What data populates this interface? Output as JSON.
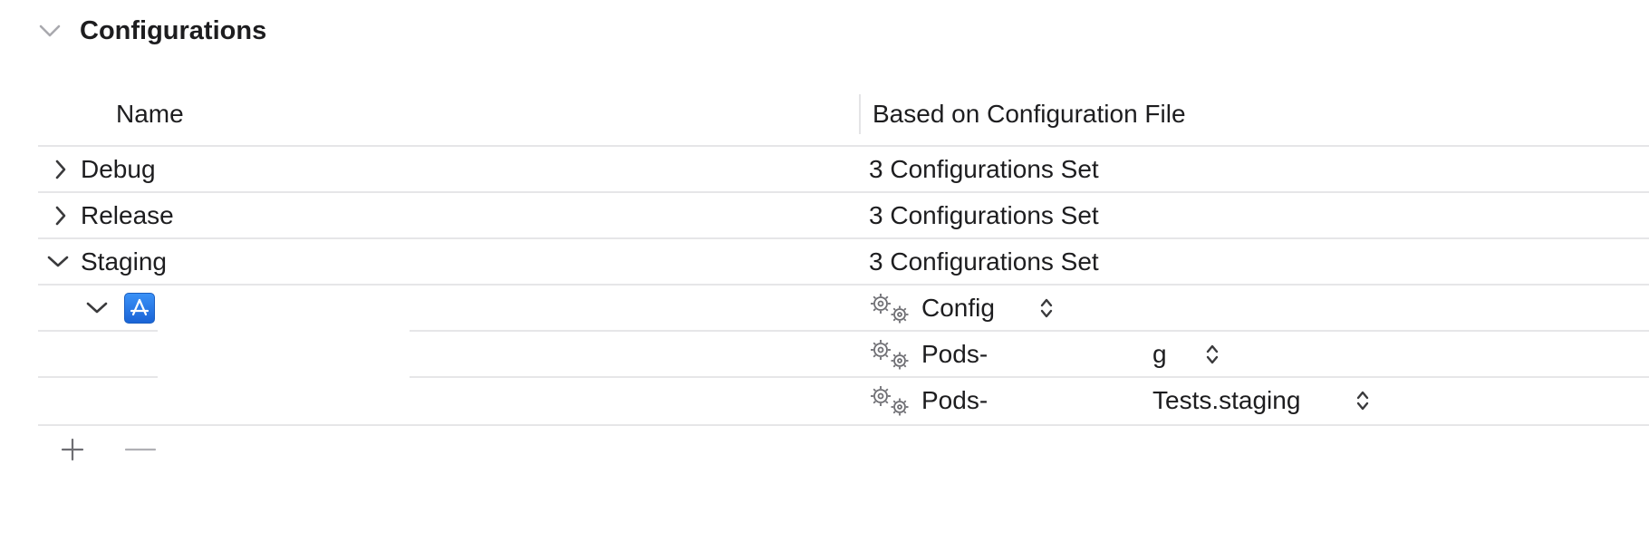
{
  "section": {
    "title": "Configurations",
    "chevron_icon": "chevron-down-icon"
  },
  "table": {
    "columns": {
      "name": "Name",
      "based_on": "Based on Configuration File"
    },
    "rows": [
      {
        "name": "Debug",
        "value": "3 Configurations Set",
        "expanded": false
      },
      {
        "name": "Release",
        "value": "3 Configurations Set",
        "expanded": false
      },
      {
        "name": "Staging",
        "value": "3 Configurations Set",
        "expanded": true
      }
    ],
    "staging_targets": [
      {
        "icon": "app-store-icon",
        "config_file": "Config"
      },
      {
        "config_file_prefix": "Pods-",
        "config_file_suffix": "g"
      },
      {
        "config_file_prefix": "Pods-",
        "config_file_suffix": "Tests.staging"
      }
    ]
  },
  "footer": {
    "add_icon": "plus-icon",
    "remove_icon": "minus-icon"
  },
  "colors": {
    "divider": "#e6e6e8",
    "text": "#1d1d1f",
    "icon_gray": "#6e6e73",
    "accent_blue": "#1a64d6"
  }
}
